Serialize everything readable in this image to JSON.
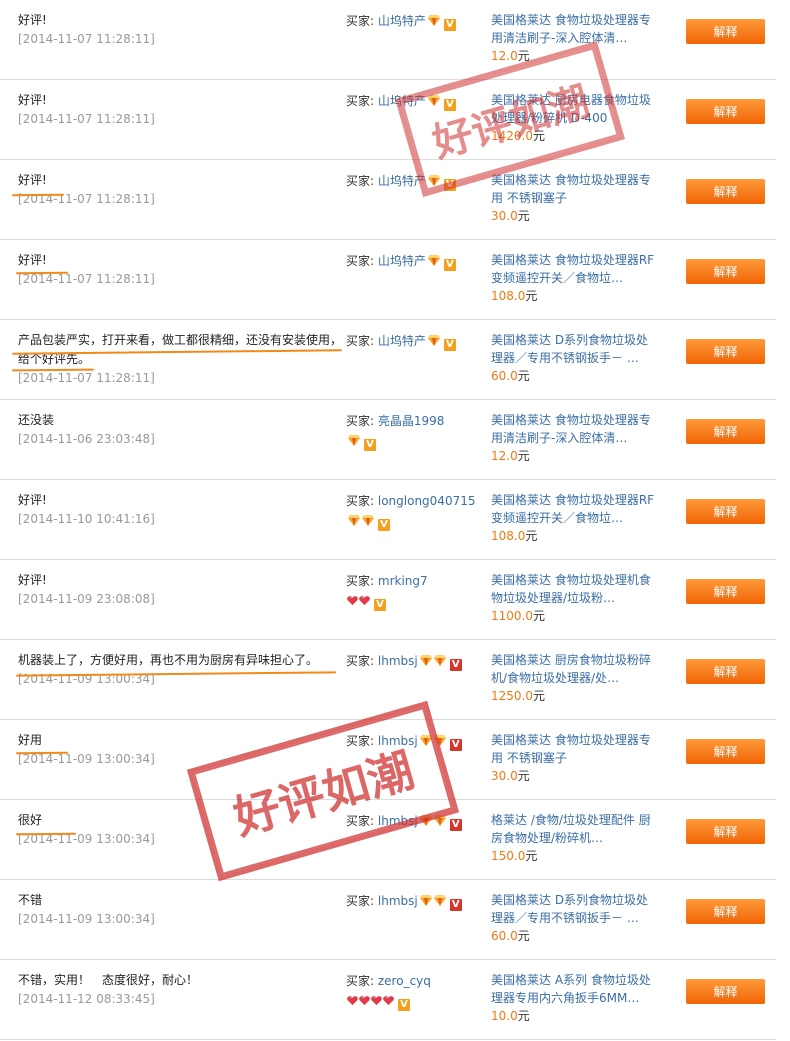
{
  "button_label": "解释",
  "buyer_label": "买家:",
  "currency": "元",
  "colors": {
    "accent": "#f06406",
    "link": "#3a6ea5",
    "price": "#ef7a12",
    "stamp": "#ce2c2c"
  },
  "stamp_text": "好评如潮",
  "rows": [
    {
      "comment": "好评!",
      "timestamp": "[2014-11-07 11:28:11]",
      "buyer": "山坞特产",
      "product": "美国格莱达 食物垃圾处理器专用清洁刷子-深入腔体清…",
      "price": "12.0"
    },
    {
      "comment": "好评!",
      "timestamp": "[2014-11-07 11:28:11]",
      "buyer": "山坞特产",
      "product": "美国格莱达 厨房电器食物垃圾处理器/粉碎机 D-400",
      "price": "1420.0"
    },
    {
      "comment": "好评!",
      "timestamp": "[2014-11-07 11:28:11]",
      "buyer": "山坞特产",
      "product": "美国格莱达 食物垃圾处理器专用 不锈钢塞子",
      "price": "30.0"
    },
    {
      "comment": "好评!",
      "timestamp": "[2014-11-07 11:28:11]",
      "buyer": "山坞特产",
      "product": "美国格莱达 食物垃圾处理器RF变频遥控开关／食物垃…",
      "price": "108.0"
    },
    {
      "comment": "产品包装严实，打开来看，做工都很精细，还没有安装使用，给个好评先。",
      "timestamp": "[2014-11-07 11:28:11]",
      "buyer": "山坞特产",
      "product": "美国格莱达 D系列食物垃圾处理器／专用不锈钢扳手－ …",
      "price": "60.0"
    },
    {
      "comment": "还没装",
      "timestamp": "[2014-11-06 23:03:48]",
      "buyer": "亮晶晶1998",
      "product": "美国格莱达 食物垃圾处理器专用清洁刷子-深入腔体清…",
      "price": "12.0"
    },
    {
      "comment": "好评!",
      "timestamp": "[2014-11-10 10:41:16]",
      "buyer": "longlong040715",
      "product": "美国格莱达 食物垃圾处理器RF变频遥控开关／食物垃…",
      "price": "108.0"
    },
    {
      "comment": "好评!",
      "timestamp": "[2014-11-09 23:08:08]",
      "buyer": "mrking7",
      "product": "美国格莱达 食物垃圾处理机食物垃圾处理器/垃圾粉…",
      "price": "1100.0"
    },
    {
      "comment": "机器装上了，方便好用，再也不用为厨房有异味担心了。",
      "timestamp": "[2014-11-09 13:00:34]",
      "buyer": "lhmbsj",
      "product": "美国格莱达 厨房食物垃圾粉碎机/食物垃圾处理器/处…",
      "price": "1250.0"
    },
    {
      "comment": "好用",
      "timestamp": "[2014-11-09 13:00:34]",
      "buyer": "lhmbsj",
      "product": "美国格莱达 食物垃圾处理器专用 不锈钢塞子",
      "price": "30.0"
    },
    {
      "comment": "很好",
      "timestamp": "[2014-11-09 13:00:34]",
      "buyer": "lhmbsj",
      "product": "格莱达 /食物/垃圾处理配件 厨房食物处理/粉碎机…",
      "price": "150.0"
    },
    {
      "comment": "不错",
      "timestamp": "[2014-11-09 13:00:34]",
      "buyer": "lhmbsj",
      "product": "美国格莱达 D系列食物垃圾处理器／专用不锈钢扳手－ …",
      "price": "60.0"
    },
    {
      "comment": "不错，实用！　态度很好，耐心！",
      "timestamp": "[2014-11-12 08:33:45]",
      "buyer": "zero_cyq",
      "product": "美国格莱达 A系列 食物垃圾处理器专用内六角扳手6MM…",
      "price": "10.0"
    }
  ]
}
